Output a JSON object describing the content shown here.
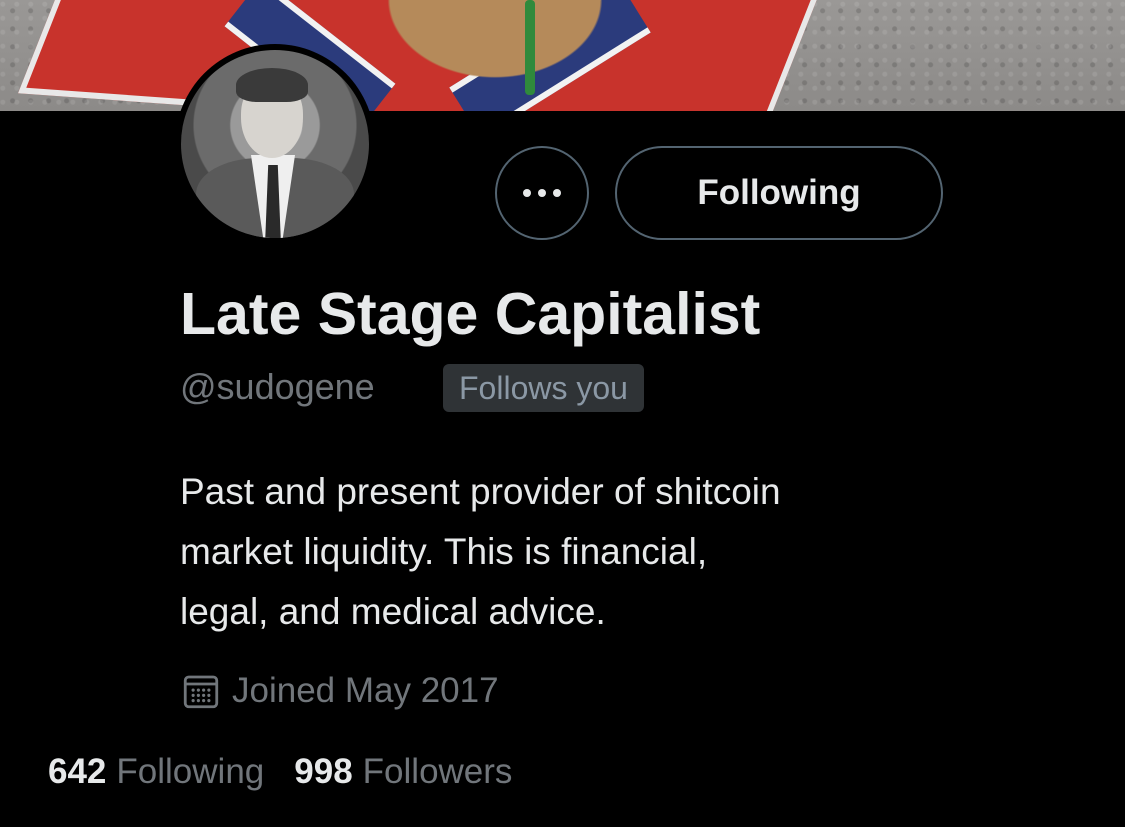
{
  "profile": {
    "display_name": "Late Stage Capitalist",
    "handle": "@sudogene",
    "follows_you_badge": "Follows you",
    "bio_lines": [
      "Past and present provider of shitcoin",
      "market liquidity. This is financial,",
      "legal, and medical advice."
    ],
    "joined": "Joined May 2017",
    "joined_icon": "calendar-icon"
  },
  "actions": {
    "more_icon": "more-dots-icon",
    "following_label": "Following"
  },
  "stats": {
    "following_count": "642",
    "following_label": "Following",
    "followers_count": "998",
    "followers_label": "Followers"
  },
  "colors": {
    "background": "#000000",
    "primary_text": "#e7e9ea",
    "secondary_text": "#71767b",
    "border": "#536471",
    "badge_bg": "#2f3336"
  }
}
